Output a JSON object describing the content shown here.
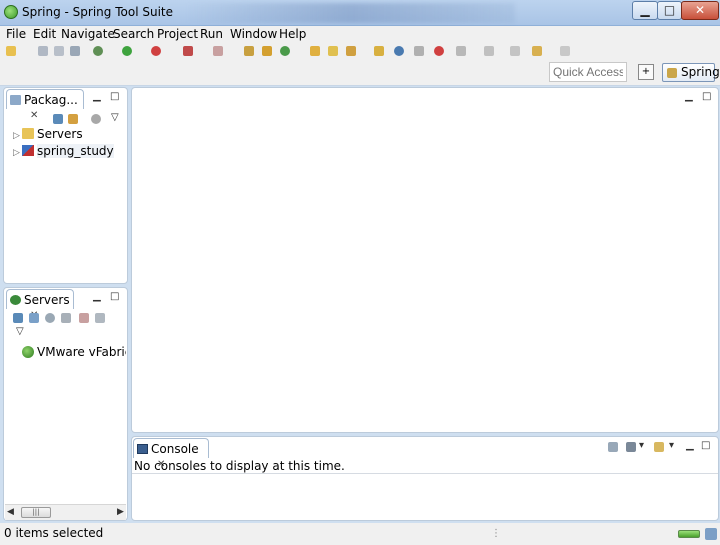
{
  "window": {
    "title": "Spring - Spring Tool Suite",
    "controls": {
      "minimize": "▁",
      "maximize": "□",
      "close": "✕"
    }
  },
  "menu": [
    "File",
    "Edit",
    "Navigate",
    "Search",
    "Project",
    "Run",
    "Window",
    "Help"
  ],
  "toolbar": {
    "quick_access_placeholder": "Quick Access",
    "perspective_label": "Spring"
  },
  "package_explorer": {
    "tab_label": "Packag...",
    "close_glyph": "✕",
    "items": [
      {
        "label": "Servers",
        "icon": "folder-icon"
      },
      {
        "label": "spring_study",
        "icon": "web-project-icon"
      }
    ]
  },
  "servers_view": {
    "tab_label": "Servers",
    "close_glyph": "✕",
    "entry": "VMware vFabric tc"
  },
  "console_view": {
    "tab_label": "Console",
    "close_glyph": "✕",
    "message": "No consoles to display at this time."
  },
  "status": {
    "text": "0 items selected"
  },
  "colors": {
    "accent": "#a9c4e6",
    "view_border": "#bccbdb",
    "run_green": "#3ea33e",
    "debug_red": "#d04040"
  }
}
